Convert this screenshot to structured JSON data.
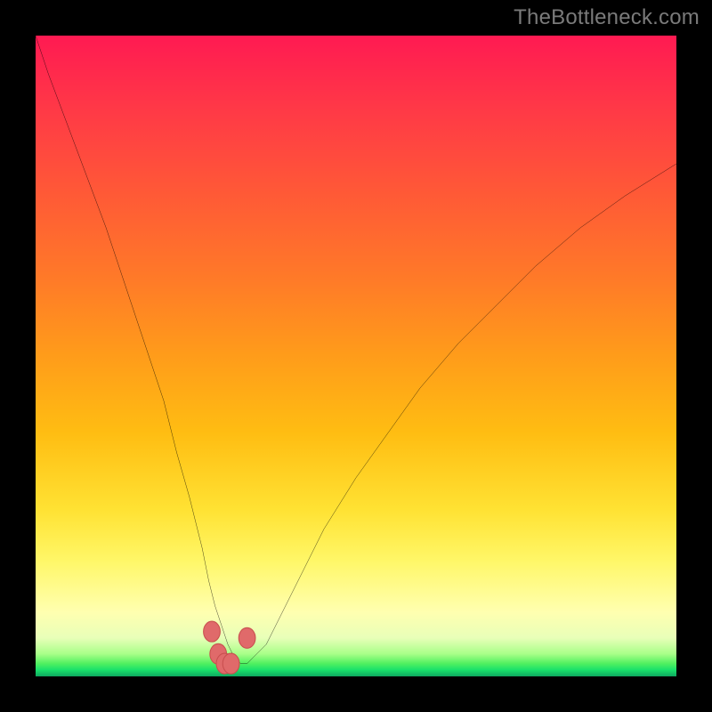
{
  "watermark": {
    "text": "TheBottleneck.com"
  },
  "palette": {
    "curve_stroke": "#000000",
    "marker_fill": "#e06a6a",
    "marker_stroke": "#c94f4f",
    "background_black": "#000000"
  },
  "chart_data": {
    "type": "line",
    "title": "",
    "xlabel": "",
    "ylabel": "",
    "xlim": [
      0,
      100
    ],
    "ylim": [
      0,
      100
    ],
    "grid": false,
    "legend": false,
    "x": [
      0,
      2,
      5,
      8,
      11,
      14,
      17,
      20,
      22,
      24,
      26,
      27,
      28,
      29,
      30,
      31,
      32,
      33,
      34,
      36,
      38,
      41,
      45,
      50,
      55,
      60,
      66,
      72,
      78,
      85,
      92,
      100
    ],
    "values": [
      100,
      94,
      86,
      78,
      70,
      61,
      52,
      43,
      35,
      28,
      20,
      15,
      11,
      8,
      5,
      3,
      2,
      2,
      3,
      5,
      9,
      15,
      23,
      31,
      38,
      45,
      52,
      58,
      64,
      70,
      75,
      80
    ],
    "markers": {
      "x": [
        27.5,
        28.5,
        29.5,
        30.5,
        33.0
      ],
      "values": [
        7.0,
        3.5,
        2.0,
        2.0,
        6.0
      ]
    }
  }
}
